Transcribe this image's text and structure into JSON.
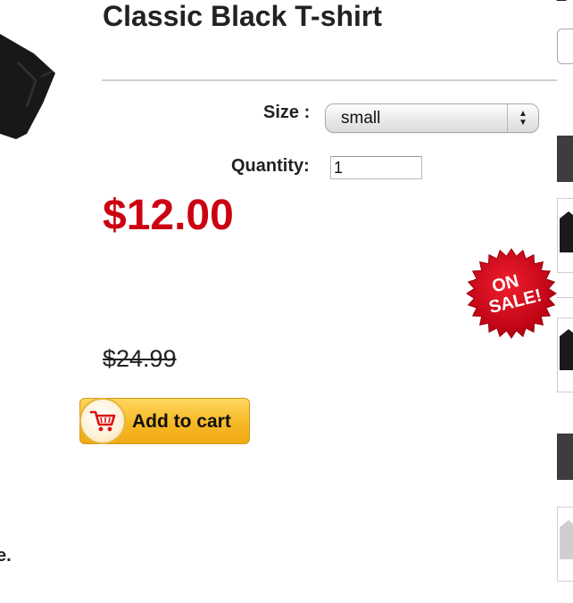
{
  "product": {
    "title": "Classic Black T-shirt",
    "size_label": "Size :",
    "size_value": "small",
    "quantity_label": "Quantity:",
    "quantity_value": "1",
    "sale_price": "$12.00",
    "original_price": "$24.99",
    "add_to_cart_label": "Add to cart",
    "badge_text": [
      "ON",
      "SALE!"
    ],
    "cropped_text": "e."
  },
  "sidebar": {
    "top_text": "E"
  },
  "colors": {
    "price_red": "#cc0011",
    "button_gold": "#f6b826",
    "badge_red": "#d4001a",
    "sidebar_header": "#3d3d3d"
  },
  "icons": {
    "cart": "shopping-cart-icon",
    "select": "select-arrows-icon"
  }
}
